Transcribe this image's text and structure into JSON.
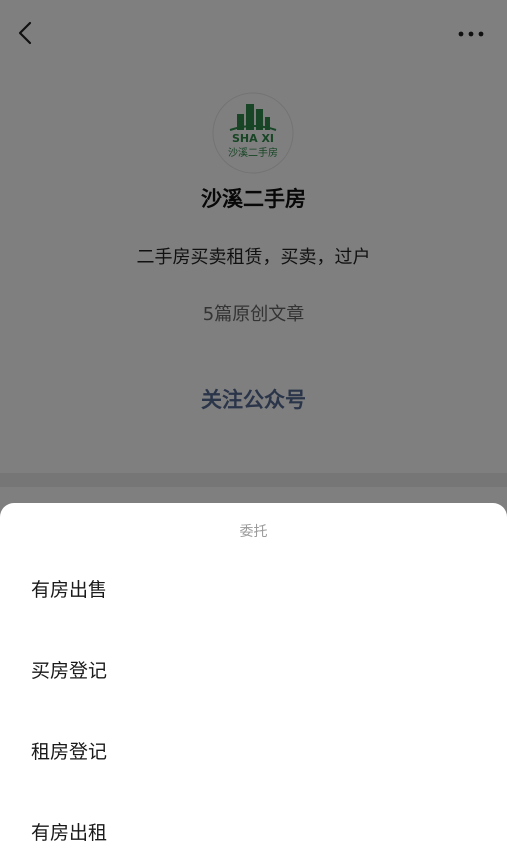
{
  "profile": {
    "name": "沙溪二手房",
    "description": "二手房买卖租赁，买卖，过户",
    "article_count": "5篇原创文章",
    "follow_label": "关注公众号",
    "avatar_text_en": "SHA XI",
    "avatar_text_cn": "沙溪二手房"
  },
  "sheet": {
    "title": "委托",
    "items": [
      {
        "label": "有房出售"
      },
      {
        "label": "买房登记"
      },
      {
        "label": "租房登记"
      },
      {
        "label": "有房出租"
      }
    ]
  },
  "colors": {
    "link": "#576b95",
    "logo_green": "#2e8b4a"
  }
}
